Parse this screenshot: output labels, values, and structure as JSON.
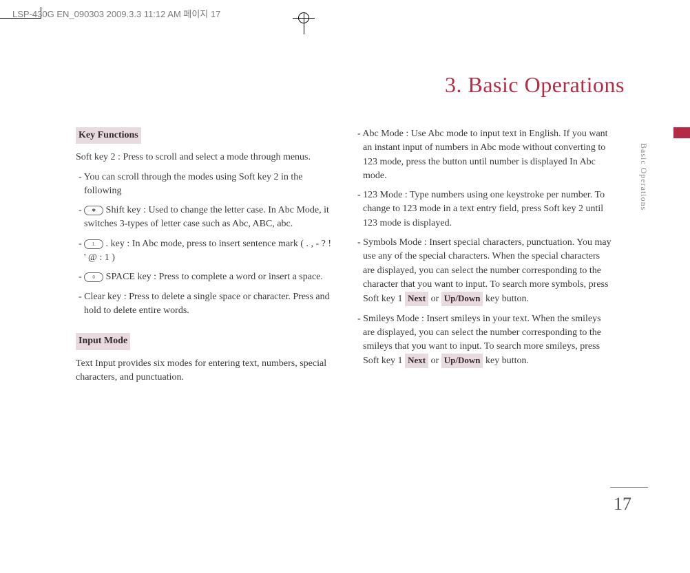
{
  "header": {
    "meta": "LSP-430G EN_090303  2009.3.3 11:12 AM  페이지 17"
  },
  "chapter_title": "3. Basic Operations",
  "side_label": "Basic Operations",
  "page_number": "17",
  "left": {
    "key_functions_heading": "Key Functions",
    "kf_intro": "Soft key 2 : Press to scroll and select a mode through menus.",
    "kf_item1": "- You can scroll through the modes using Soft key 2 in the following",
    "kf_item2_a": "- ",
    "kf_item2_b": " Shift key : Used to change the letter case.  In Abc Mode, it switches 3-types of letter case such as Abc, ABC, abc.",
    "kf_item3_a": "- ",
    "kf_item3_b": " . key : In Abc mode, press to insert sentence mark ( .  ,  -  ?  !  '  @  :  1 )",
    "kf_item4_a": "- ",
    "kf_item4_b": " SPACE key : Press to complete a word or insert a space.",
    "kf_item5": "- Clear key : Press to delete a single space or character. Press and hold to delete entire words.",
    "input_mode_heading": "Input Mode",
    "im_intro": "Text Input provides six modes for entering text, numbers, special characters, and punctuation."
  },
  "right": {
    "abc_mode": "- Abc Mode : Use Abc mode to input text in English. If you want an instant input of numbers in Abc mode without converting to 123 mode, press the button until number is displayed In Abc mode.",
    "mode_123": "- 123  Mode : Type numbers using one keystroke per number. To change to 123 mode in a text entry field, press Soft key 2 until 123 mode is displayed.",
    "symbols_a": "- Symbols Mode : Insert special characters, punctuation. You may use any of the special characters. When the special characters are displayed, you can select the number corresponding to the character that you want to input. To search more symbols, press Soft key 1 ",
    "symbols_b": " or ",
    "symbols_c": " key button.",
    "smileys_a": "- Smileys Mode : Insert smileys in your text. When the smileys are displayed, you can select the number corresponding to the smileys that you want to input. To search more smileys, press Soft key 1 ",
    "smileys_b": " or ",
    "smileys_c": " key button.",
    "btn_next": "Next",
    "btn_updown": "Up/Down"
  }
}
